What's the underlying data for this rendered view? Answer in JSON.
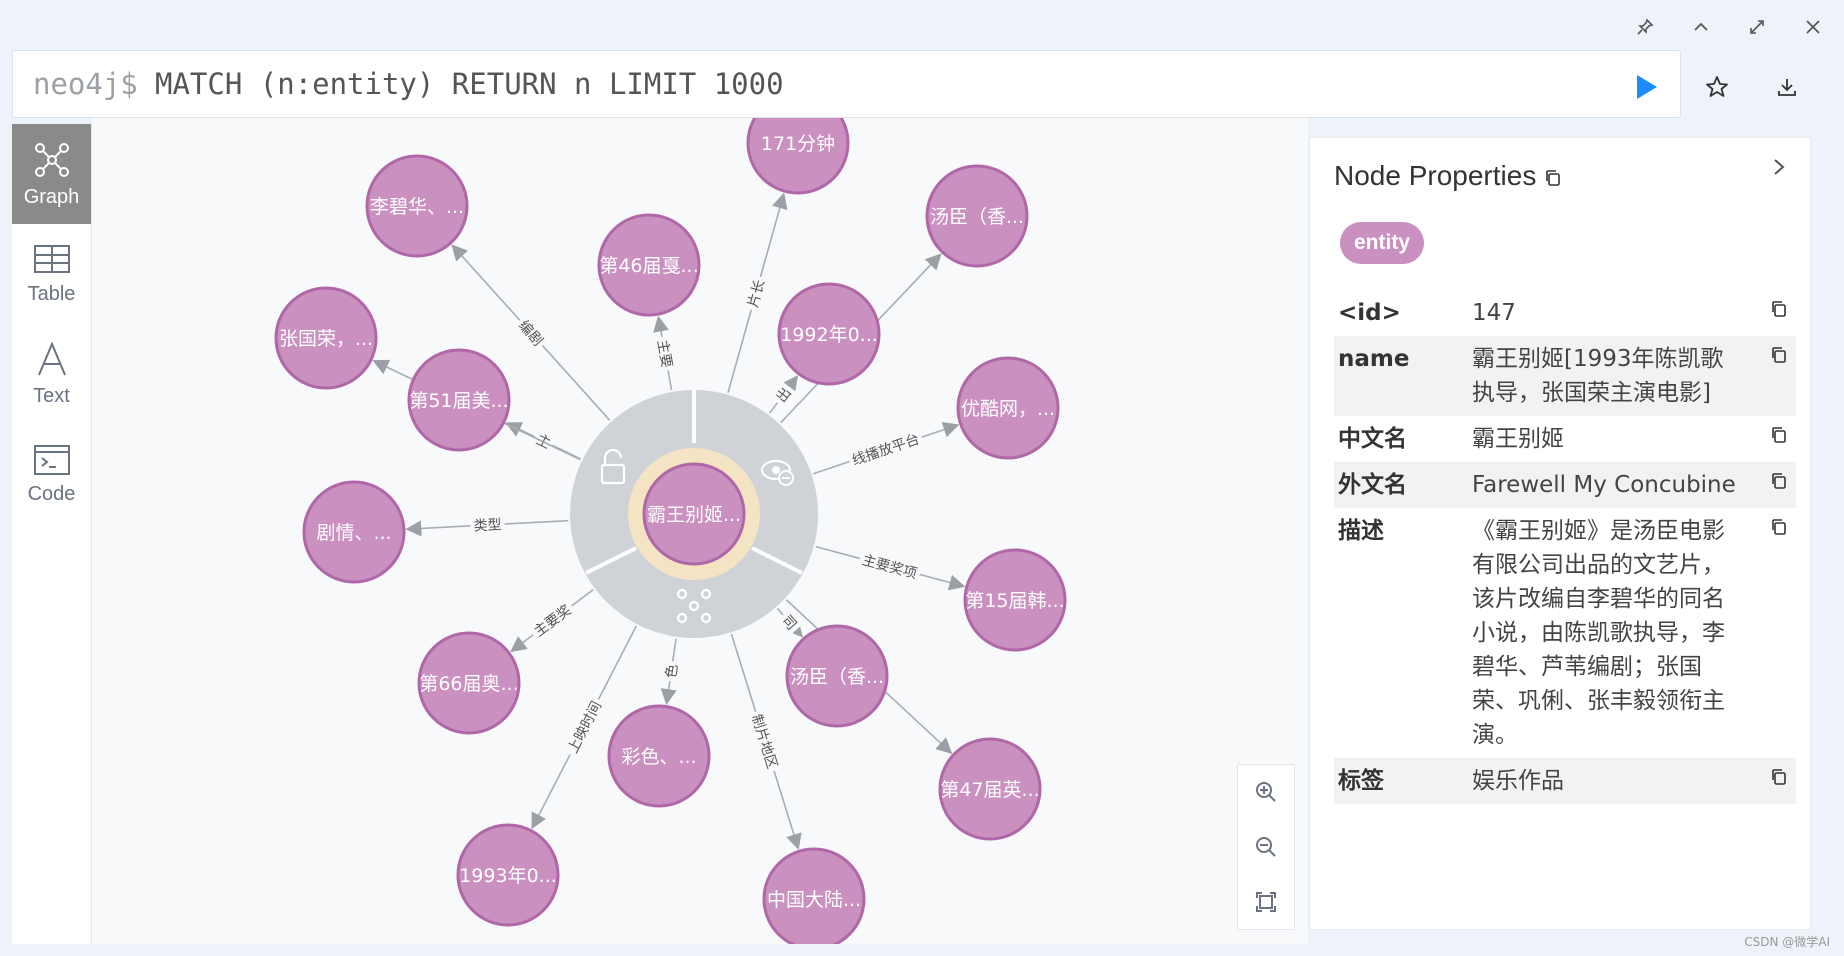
{
  "editor": {
    "prompt": "neo4j$",
    "query": "MATCH (n:entity) RETURN n LIMIT 1000"
  },
  "top_controls": [
    "pin-icon",
    "chevron-up-icon",
    "expand-icon",
    "close-icon"
  ],
  "sidebar": {
    "items": [
      {
        "label": "Graph",
        "icon": "graph-icon",
        "active": true
      },
      {
        "label": "Table",
        "icon": "table-icon",
        "active": false
      },
      {
        "label": "Text",
        "icon": "text-icon",
        "active": false
      },
      {
        "label": "Code",
        "icon": "code-icon",
        "active": false
      }
    ]
  },
  "graph": {
    "node_color": "#c990c0",
    "node_stroke": "#b067a8",
    "center": {
      "label": "霸王别姬..."
    },
    "nodes": [
      {
        "label": "171分钟",
        "rel": "片长"
      },
      {
        "label": "汤臣（香...",
        "rel": ""
      },
      {
        "label": "1992年0...",
        "rel": "出"
      },
      {
        "label": "优酷网，...",
        "rel": "线播放平台"
      },
      {
        "label": "第15届韩...",
        "rel": "主要奖项"
      },
      {
        "label": "汤臣（香...",
        "rel": "司"
      },
      {
        "label": "第47届英...",
        "rel": ""
      },
      {
        "label": "中国大陆...",
        "rel": "制片地区"
      },
      {
        "label": "彩色、...",
        "rel": "色"
      },
      {
        "label": "1993年0...",
        "rel": "上映时间"
      },
      {
        "label": "第66届奥...",
        "rel": "主要奖"
      },
      {
        "label": "剧情、...",
        "rel": "类型"
      },
      {
        "label": "第51届美...",
        "rel": "主"
      },
      {
        "label": "张国荣，...",
        "rel": ""
      },
      {
        "label": "李碧华、...",
        "rel": "编剧"
      },
      {
        "label": "第46届戛...",
        "rel": "主要"
      }
    ]
  },
  "props": {
    "title": "Node Properties",
    "label": "entity",
    "rows": [
      {
        "key": "<id>",
        "value": "147"
      },
      {
        "key": "name",
        "value": "霸王别姬[1993年陈凯歌执导，张国荣主演电影]"
      },
      {
        "key": "中文名",
        "value": "霸王别姬"
      },
      {
        "key": "外文名",
        "value": "Farewell My Concubine"
      },
      {
        "key": "描述",
        "value": "《霸王别姬》是汤臣电影有限公司出品的文艺片，该片改编自李碧华的同名小说，由陈凯歌执导，李碧华、芦苇编剧；张国荣、巩俐、张丰毅领衔主演。"
      },
      {
        "key": "标签",
        "value": "娱乐作品"
      }
    ]
  },
  "watermark": "CSDN @微学AI"
}
